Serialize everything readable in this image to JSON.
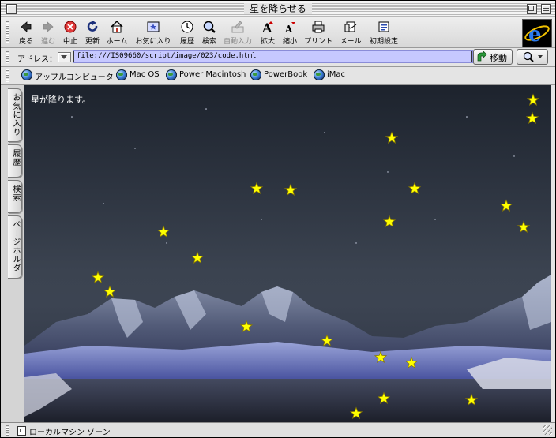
{
  "window": {
    "title": "星を降らせる"
  },
  "toolbar": {
    "buttons": [
      {
        "label": "戻る",
        "enabled": true,
        "icon": "back-arrow-icon"
      },
      {
        "label": "進む",
        "enabled": false,
        "icon": "forward-arrow-icon"
      },
      {
        "label": "中止",
        "enabled": true,
        "icon": "stop-icon"
      },
      {
        "label": "更新",
        "enabled": true,
        "icon": "refresh-icon"
      },
      {
        "label": "ホーム",
        "enabled": true,
        "icon": "home-icon"
      },
      {
        "label": "お気に入り",
        "enabled": true,
        "icon": "favorites-icon"
      },
      {
        "label": "履歴",
        "enabled": true,
        "icon": "history-icon"
      },
      {
        "label": "検索",
        "enabled": true,
        "icon": "search-icon"
      },
      {
        "label": "自動入力",
        "enabled": false,
        "icon": "autofill-icon"
      },
      {
        "label": "拡大",
        "enabled": true,
        "icon": "text-larger-icon"
      },
      {
        "label": "縮小",
        "enabled": true,
        "icon": "text-smaller-icon"
      },
      {
        "label": "プリント",
        "enabled": true,
        "icon": "print-icon"
      },
      {
        "label": "メール",
        "enabled": true,
        "icon": "mail-icon"
      },
      {
        "label": "初期設定",
        "enabled": true,
        "icon": "preferences-icon"
      }
    ]
  },
  "address": {
    "label": "アドレス：",
    "url": "file:///IS09660/script/image/023/code.html",
    "go_label": "移動"
  },
  "favorites": [
    {
      "label": "アップルコンピュータ"
    },
    {
      "label": "Mac OS"
    },
    {
      "label": "Power Macintosh"
    },
    {
      "label": "PowerBook"
    },
    {
      "label": "iMac"
    }
  ],
  "sidebar_tabs": [
    {
      "label": "お気に入り"
    },
    {
      "label": "履歴"
    },
    {
      "label": "検索"
    },
    {
      "label": "ページホルダ"
    }
  ],
  "page": {
    "text": "星が降ります。",
    "star_color": "#ffff00"
  },
  "status": {
    "text": "ローカルマシン ゾーン"
  },
  "colors": {
    "address_field": "#c6c8ff",
    "star": "#ffff00",
    "star_outline": "#8a7a00"
  }
}
